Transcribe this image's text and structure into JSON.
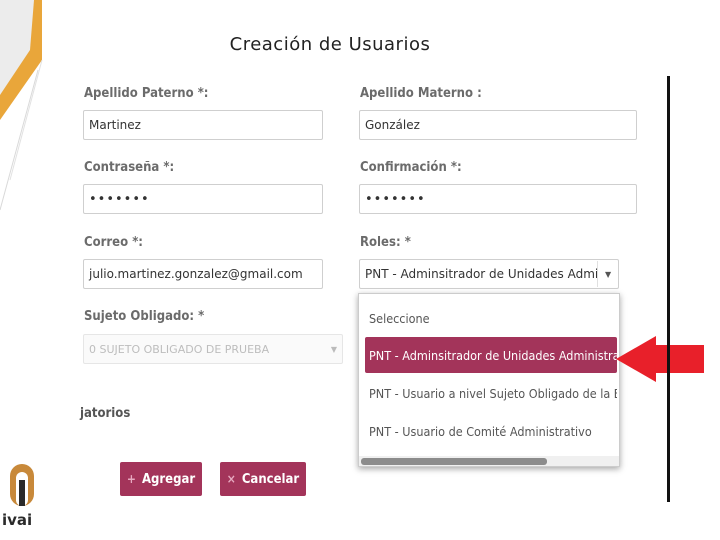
{
  "page_title": "Creación de Usuarios",
  "form": {
    "apellido_paterno": {
      "label": "Apellido Paterno *:",
      "value": "Martinez"
    },
    "apellido_materno": {
      "label": "Apellido Materno :",
      "value": "González"
    },
    "contrasena": {
      "label": "Contraseña *:",
      "value": "•••••••"
    },
    "confirmacion": {
      "label": "Confirmación *:",
      "value": "•••••••"
    },
    "correo": {
      "label": "Correo *:",
      "value": "julio.martinez.gonzalez@gmail.com"
    },
    "roles": {
      "label": "Roles: *",
      "value": "PNT - Adminsitrador de Unidades Admi"
    },
    "sujeto_obligado": {
      "label": "Sujeto Obligado: *",
      "value": "0 SUJETO OBLIGADO DE PRUEBA"
    },
    "section_tail": "jatorios"
  },
  "roles_dropdown": {
    "options": [
      "Seleccione",
      "PNT - Adminsitrador de Unidades Administrativas",
      "PNT - Usuario a nivel Sujeto Obligado de la B",
      "PNT - Usuario de Comité Administrativo"
    ],
    "selected_index": 1
  },
  "buttons": {
    "agregar": {
      "icon": "+",
      "label": "Agregar"
    },
    "cancelar": {
      "icon": "×",
      "label": "Cancelar"
    }
  },
  "logo": {
    "text": "ivai"
  },
  "colors": {
    "accent": "#a3345a",
    "arrow": "#e8202a",
    "corner_gold": "#e9a63a"
  }
}
